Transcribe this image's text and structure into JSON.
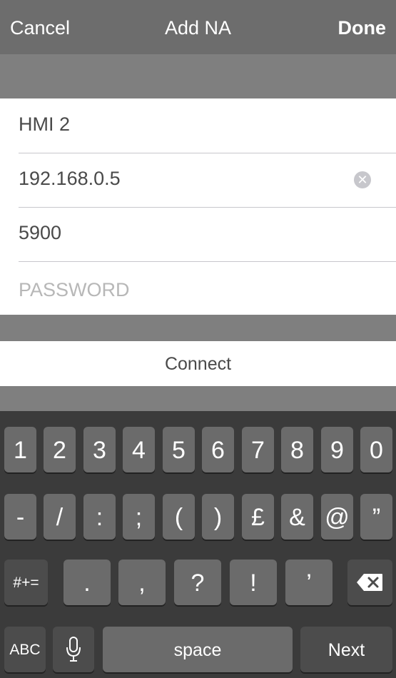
{
  "navbar": {
    "cancel_label": "Cancel",
    "title": "Add NA",
    "done_label": "Done"
  },
  "form": {
    "name_value": "HMI 2",
    "ip_value": "192.168.0.5",
    "port_value": "5900",
    "password_placeholder": "PASSWORD"
  },
  "connect_label": "Connect",
  "keyboard": {
    "row1": [
      "1",
      "2",
      "3",
      "4",
      "5",
      "6",
      "7",
      "8",
      "9",
      "0"
    ],
    "row2": [
      "-",
      "/",
      ":",
      ";",
      "(",
      ")",
      "£",
      "&",
      "@",
      "”"
    ],
    "toggle_symbols_label": "#+=",
    "row3": [
      ".",
      ",",
      "?",
      "!",
      "’"
    ],
    "abc_label": "ABC",
    "space_label": "space",
    "next_label": "Next"
  },
  "colors": {
    "navbar_bg": "#6d6d6d",
    "page_bg": "#7f7f7f",
    "keyboard_bg": "#3b3b3b",
    "key_bg": "#6b6b6b"
  }
}
